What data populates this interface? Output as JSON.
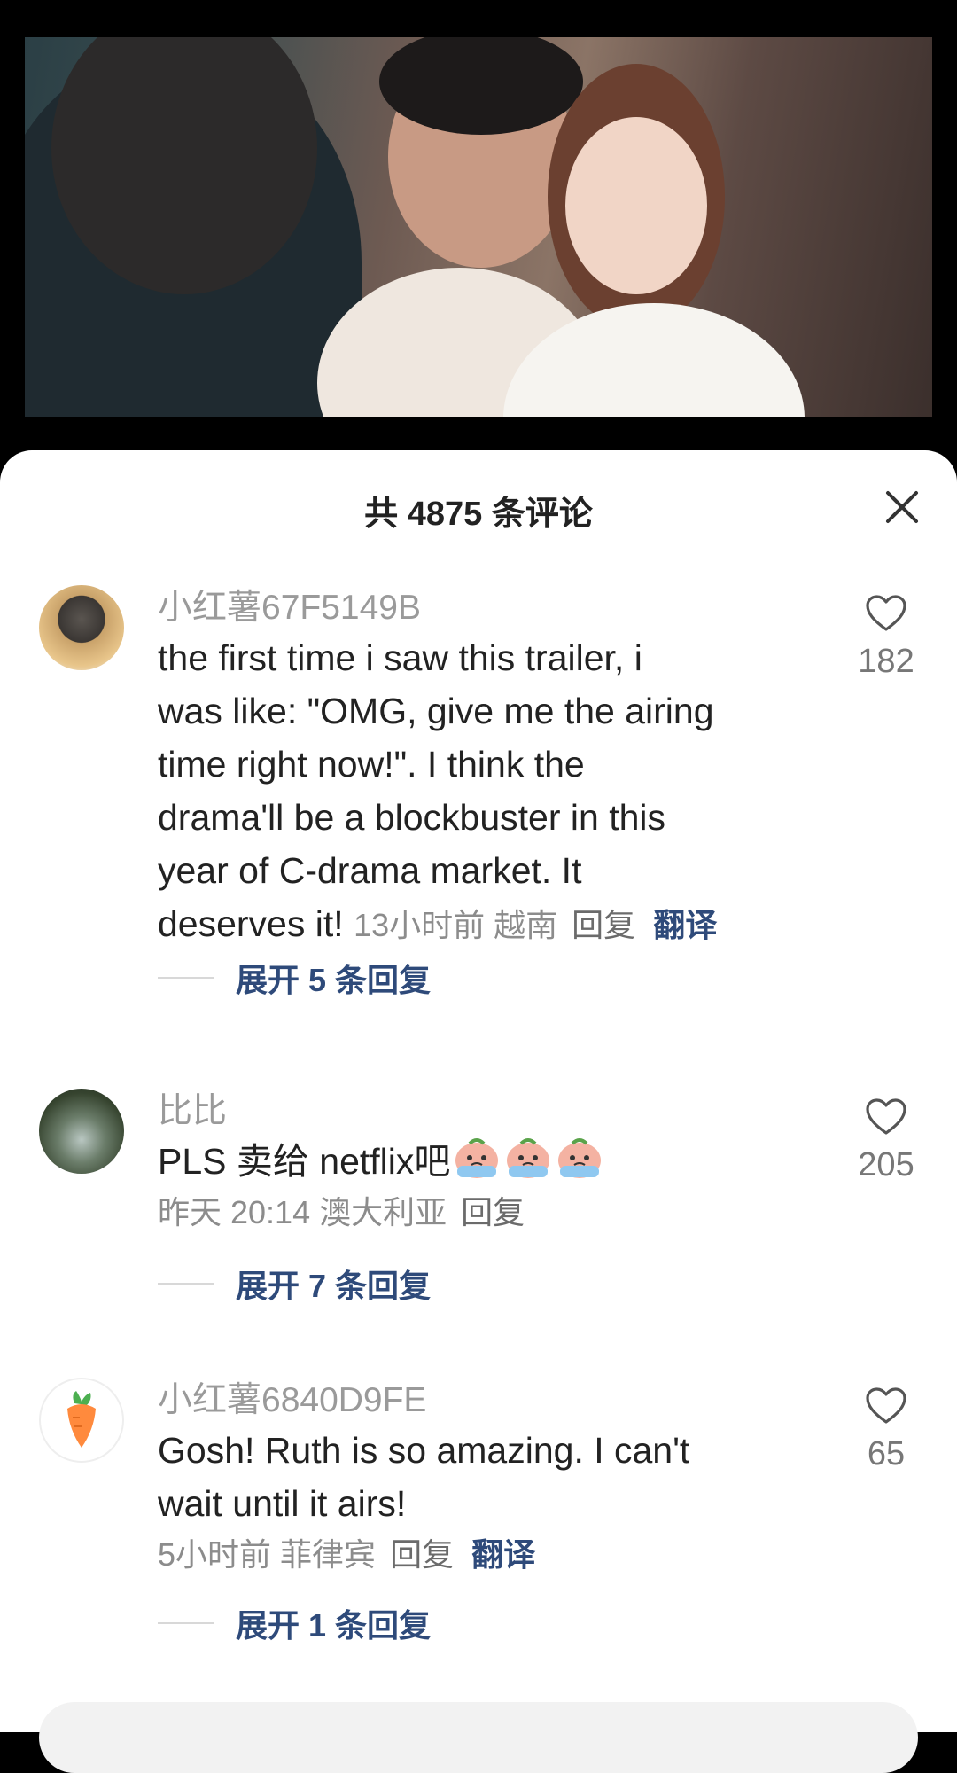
{
  "header": {
    "title": "共 4875 条评论"
  },
  "icons": {
    "close": "close-icon",
    "like": "heart-outline-icon"
  },
  "comments": [
    {
      "username": "小红薯67F5149B",
      "text": "the first time i saw this trailer, i was like: \"OMG, give me the airing time right now!\". I think the drama'll be a blockbuster in this year of C-drama market. It deserves it!",
      "text_lines": [
        "the first time i saw this trailer, i",
        "was like: \"OMG, give me the airing",
        "time right now!\". I think the",
        "drama'll be a blockbuster in this",
        "year of C-drama market. It",
        "deserves it!"
      ],
      "time": "13小时前",
      "location": "越南",
      "reply_label": "回复",
      "translate_label": "翻译",
      "likes": "182",
      "expand_label": "展开 5 条回复"
    },
    {
      "username": "比比",
      "text": "PLS 卖给 netflix吧",
      "time": "昨天 20:14",
      "location": "澳大利亚",
      "reply_label": "回复",
      "likes": "205",
      "expand_label": "展开 7 条回复"
    },
    {
      "username": "小红薯6840D9FE",
      "text": "Gosh! Ruth is so amazing. I can't wait until it airs!",
      "text_lines": [
        "Gosh! Ruth is so amazing. I can't",
        "wait until it airs!"
      ],
      "time": "5小时前",
      "location": "菲律宾",
      "reply_label": "回复",
      "translate_label": "翻译",
      "likes": "65",
      "expand_label": "展开 1 条回复"
    }
  ],
  "colors": {
    "link_blue": "#2e4a7a",
    "username_gray": "#9a9a9a",
    "text_dark": "#222222"
  }
}
